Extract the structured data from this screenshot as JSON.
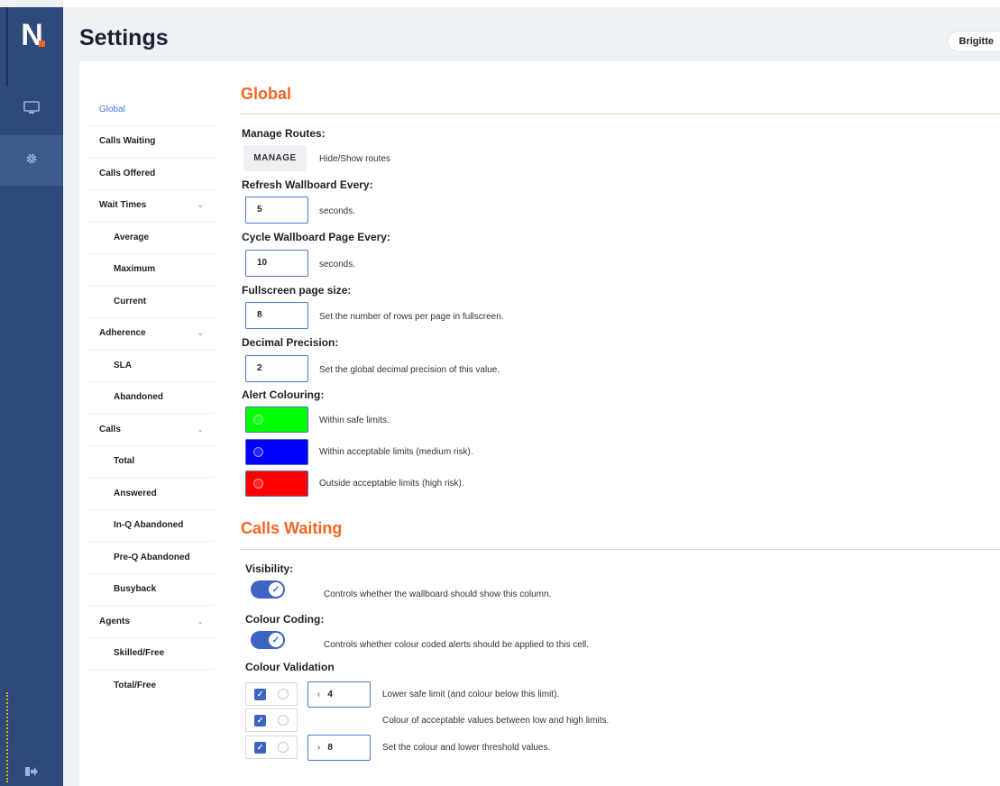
{
  "app": {
    "logo_text": "N",
    "brand_accent": "#f26522",
    "rail_color": "#2f4a7a"
  },
  "header": {
    "title": "Settings",
    "user_name": "Brigitte"
  },
  "rail": {
    "items": [
      {
        "icon": "monitor-icon"
      },
      {
        "icon": "gear-icon"
      },
      {
        "icon": "logout-icon"
      }
    ]
  },
  "nav": {
    "items": [
      {
        "label": "Global",
        "active": true
      },
      {
        "label": "Calls Waiting"
      },
      {
        "label": "Calls Offered"
      },
      {
        "label": "Wait Times",
        "expandable": true
      },
      {
        "label": "Average",
        "sub": true
      },
      {
        "label": "Maximum",
        "sub": true
      },
      {
        "label": "Current",
        "sub": true
      },
      {
        "label": "Adherence",
        "expandable": true
      },
      {
        "label": "SLA",
        "sub": true
      },
      {
        "label": "Abandoned",
        "sub": true
      },
      {
        "label": "Calls",
        "expandable": true
      },
      {
        "label": "Total",
        "sub": true
      },
      {
        "label": "Answered",
        "sub": true
      },
      {
        "label": "In-Q Abandoned",
        "sub": true
      },
      {
        "label": "Pre-Q Abandoned",
        "sub": true
      },
      {
        "label": "Busyback",
        "sub": true
      },
      {
        "label": "Agents",
        "expandable": true
      },
      {
        "label": "Skilled/Free",
        "sub": true
      },
      {
        "label": "Total/Free",
        "sub": true
      }
    ]
  },
  "global": {
    "title": "Global",
    "manage_routes": {
      "label": "Manage Routes:",
      "button": "MANAGE",
      "desc": "Hide/Show routes"
    },
    "refresh": {
      "label": "Refresh Wallboard Every:",
      "value": "5",
      "unit": "seconds."
    },
    "cycle": {
      "label": "Cycle Wallboard Page Every:",
      "value": "10",
      "unit": "seconds."
    },
    "page_size": {
      "label": "Fullscreen page size:",
      "value": "8",
      "desc": "Set the number of rows per page in fullscreen."
    },
    "precision": {
      "label": "Decimal Precision:",
      "value": "2",
      "desc": "Set the global decimal precision of this value."
    },
    "alert": {
      "label": "Alert Colouring:",
      "items": [
        {
          "color": "#00ff00",
          "desc": "Within safe limits."
        },
        {
          "color": "#0000ff",
          "desc": "Within acceptable limits (medium risk)."
        },
        {
          "color": "#ff0000",
          "desc": "Outside acceptable limits (high risk)."
        }
      ]
    }
  },
  "calls_waiting": {
    "title": "Calls Waiting",
    "visibility": {
      "label": "Visibility:",
      "on": true,
      "desc": "Controls whether the wallboard should show this column."
    },
    "colour_coding": {
      "label": "Colour Coding:",
      "on": true,
      "desc": "Controls whether colour coded alerts should be applied to this cell."
    },
    "validation": {
      "label": "Colour Validation",
      "rows": [
        {
          "checked": true,
          "operator": "‹",
          "value": "4",
          "desc": "Lower safe limit (and colour below this limit)."
        },
        {
          "checked": true,
          "desc": "Colour of acceptable values between low and high limits."
        },
        {
          "checked": true,
          "operator": "›",
          "value": "8",
          "desc": "Set the colour and lower threshold values."
        }
      ]
    }
  }
}
